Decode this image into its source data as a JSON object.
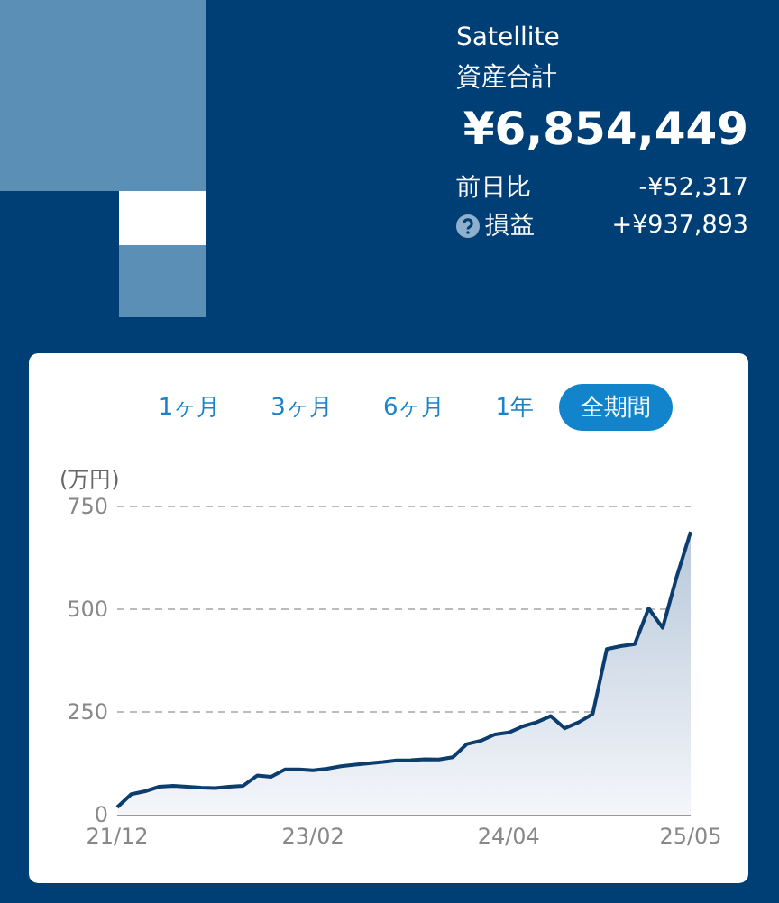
{
  "header": {
    "title": "Satellite",
    "label": "資産合計",
    "total": "¥6,854,449",
    "rows": [
      {
        "kind": "plain",
        "label": "前日比",
        "value": "-¥52,317"
      },
      {
        "kind": "help",
        "label": "損益",
        "value": "+¥937,893"
      }
    ]
  },
  "periods": [
    {
      "label": "1ヶ月",
      "selected": false
    },
    {
      "label": "3ヶ月",
      "selected": false
    },
    {
      "label": "6ヶ月",
      "selected": false
    },
    {
      "label": "1年",
      "selected": false
    },
    {
      "label": "全期間",
      "selected": true
    }
  ],
  "chart": {
    "chart_data": {
      "type": "area",
      "ylabel": "(万円)",
      "categories": [
        "21/12",
        null,
        null,
        null,
        null,
        null,
        null,
        null,
        null,
        null,
        null,
        null,
        null,
        null,
        "23/02",
        null,
        null,
        null,
        null,
        null,
        null,
        null,
        null,
        null,
        null,
        null,
        null,
        null,
        "24/04",
        null,
        null,
        null,
        null,
        null,
        null,
        null,
        null,
        null,
        null,
        null,
        null,
        "25/05"
      ],
      "series": [
        {
          "color": "#0b3d6e",
          "values": [
            18,
            50,
            57,
            68,
            70,
            68,
            66,
            65,
            68,
            70,
            95,
            92,
            110,
            110,
            108,
            112,
            118,
            122,
            125,
            128,
            132,
            133,
            135,
            134,
            140,
            172,
            180,
            195,
            200,
            215,
            225,
            240,
            210,
            225,
            245,
            403,
            410,
            415,
            502,
            455,
            578,
            688
          ]
        }
      ],
      "ylim": [
        0,
        750
      ],
      "yticks": [
        0,
        250,
        500,
        750
      ]
    }
  }
}
